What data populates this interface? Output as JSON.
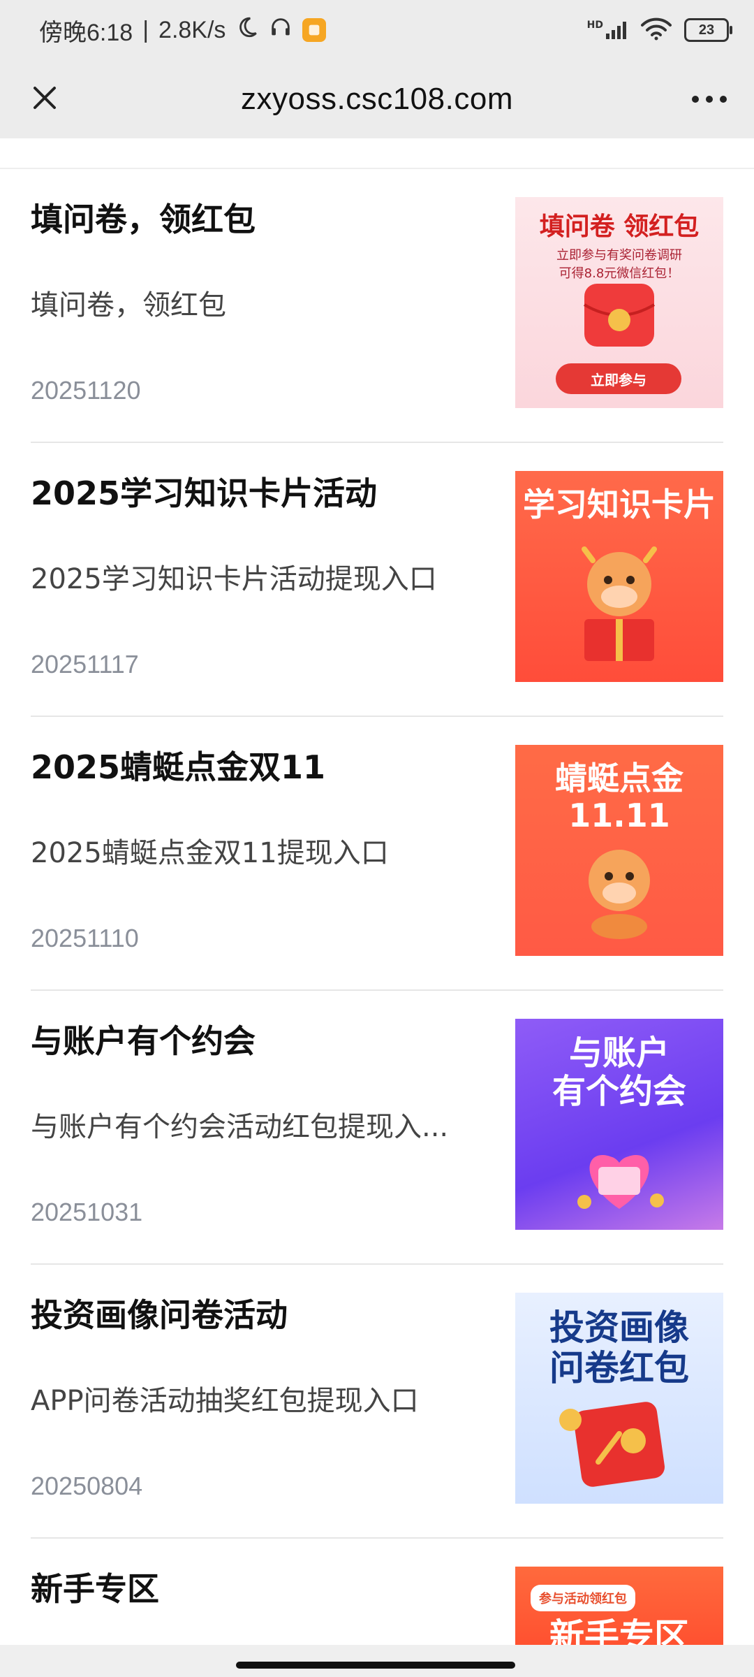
{
  "status_bar": {
    "time": "傍晚6:18",
    "speed": "2.8K/s",
    "battery": "23",
    "network": "HD"
  },
  "nav": {
    "title": "zxyoss.csc108.com"
  },
  "items": [
    {
      "title": "填问卷，领红包",
      "desc": "填问卷，领红包",
      "date": "20251120",
      "thumb_text": "填问卷 领红包",
      "thumb_sub": "立即参与有奖问卷调研\n可得8.8元微信红包！",
      "thumb_button": "立即参与"
    },
    {
      "title": "2025学习知识卡片活动",
      "desc": "2025学习知识卡片活动提现入口",
      "date": "20251117",
      "thumb_text": "学习知识卡片"
    },
    {
      "title": "2025蜻蜓点金双11",
      "desc": "2025蜻蜓点金双11提现入口",
      "date": "20251110",
      "thumb_text": "蜻蜓点金\n11.11"
    },
    {
      "title": "与账户有个约会",
      "desc": "与账户有个约会活动红包提现入...",
      "date": "20251031",
      "thumb_text": "与账户\n有个约会"
    },
    {
      "title": "投资画像问卷活动",
      "desc": "APP问卷活动抽奖红包提现入口",
      "date": "20250804",
      "thumb_text": "投资画像\n问卷红包"
    },
    {
      "title": "新手专区",
      "desc": "",
      "date": "",
      "thumb_chip": "参与活动领红包",
      "thumb_text": "新手专区"
    }
  ]
}
